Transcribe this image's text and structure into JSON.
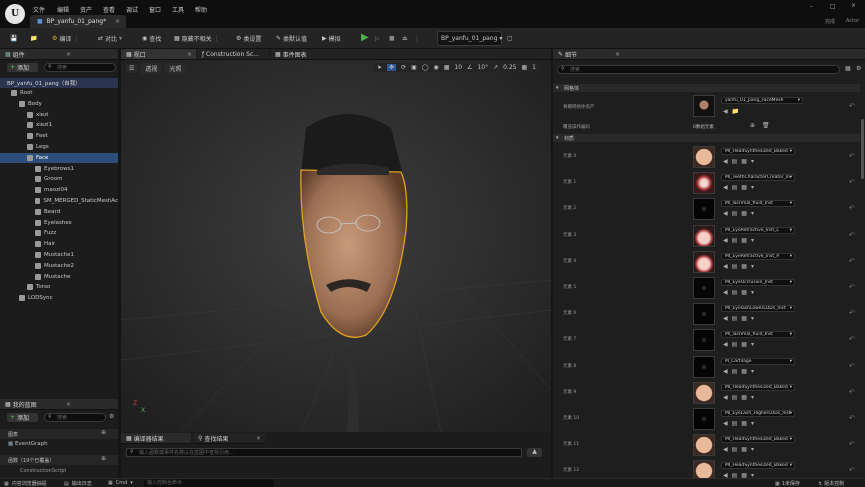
{
  "app": {
    "logo_text": "U",
    "doc_tab": "BP_yanfu_01_pang*",
    "window_right": "Actor",
    "window_right_prefix": "完成"
  },
  "menu": [
    "文件",
    "编辑",
    "资产",
    "查看",
    "调试",
    "窗口",
    "工具",
    "帮助"
  ],
  "toolbar": {
    "compile": "编译",
    "diff": "对比",
    "find": "查找",
    "hide_unrelated": "隐藏不相关",
    "class_settings": "类设置",
    "class_defaults": "类默认值",
    "simulate": "模拟",
    "debug_target": "BP_yanfu_01_pang"
  },
  "components": {
    "title": "组件",
    "add": "添加",
    "search_placeholder": "搜索",
    "root_label": "BP_yanfu_01_pang（自我）",
    "items": [
      {
        "label": "Root",
        "indent": 0
      },
      {
        "label": "Body",
        "indent": 1
      },
      {
        "label": "xiezi",
        "indent": 2
      },
      {
        "label": "xiezi1",
        "indent": 2
      },
      {
        "label": "Feet",
        "indent": 2
      },
      {
        "label": "Legs",
        "indent": 2
      },
      {
        "label": "Face",
        "indent": 2,
        "selected": true
      },
      {
        "label": "Eyebrows1",
        "indent": 3
      },
      {
        "label": "Groom",
        "indent": 3
      },
      {
        "label": "maozi04",
        "indent": 3
      },
      {
        "label": "SM_MERGED_StaticMeshAc",
        "indent": 3
      },
      {
        "label": "Beard",
        "indent": 3
      },
      {
        "label": "Eyelashes",
        "indent": 3
      },
      {
        "label": "Fuzz",
        "indent": 3
      },
      {
        "label": "Hair",
        "indent": 3
      },
      {
        "label": "Mustache1",
        "indent": 3
      },
      {
        "label": "Mustache2",
        "indent": 3
      },
      {
        "label": "Mustache",
        "indent": 3
      },
      {
        "label": "Torso",
        "indent": 2
      },
      {
        "label": "LODSync",
        "indent": 1
      }
    ]
  },
  "my_blueprint": {
    "title": "我的蓝图",
    "add": "添加",
    "search_placeholder": "搜索",
    "graph_header": "图表",
    "event_graph": "EventGraph",
    "functions_header": "函数（19个已覆盖）",
    "partial": "ConstructionScript"
  },
  "viewport": {
    "tab": "视口",
    "tab2": "Construction Sc...",
    "tab3": "事件图表",
    "perspective": "透视",
    "lit": "光照",
    "grid": "10",
    "angle": "10°",
    "scale": "0.25",
    "cam": "1"
  },
  "compiler": {
    "tab1": "编译器结果",
    "tab2": "查找结果",
    "search_placeholder": "输入函数或事件名称以在蓝图中查找引用..."
  },
  "details": {
    "title": "细节",
    "search_placeholder": "搜索",
    "mesh_section": "网格体",
    "mesh_asset_label": "骨骼网格体资产",
    "mesh_asset_value": "yanfu_01_pang_FaceMesh",
    "override_label": "覆盖操作编码",
    "override_value": "0数组元素",
    "materials_section": "材质",
    "materials": [
      {
        "label": "元素 0",
        "value": "MI_HeadSynthesized_Baked",
        "thumb": "skin"
      },
      {
        "label": "元素 1",
        "value": "MI_TeethCharacterCreator_Inst",
        "thumb": "teeth"
      },
      {
        "label": "元素 2",
        "value": "MI_lacrimal_fluid_Inst",
        "thumb": "dark"
      },
      {
        "label": "元素 3",
        "value": "MI_EyeRefractive_Inst_L",
        "thumb": "eye"
      },
      {
        "label": "元素 4",
        "value": "MI_EyeRefractive_Inst_R",
        "thumb": "eye"
      },
      {
        "label": "元素 5",
        "value": "MI_EyeOcclusion_Inst",
        "thumb": "dark"
      },
      {
        "label": "元素 6",
        "value": "MI_EyelashLowerLODs_Inst",
        "thumb": "dark"
      },
      {
        "label": "元素 7",
        "value": "MI_lacrimal_fluid_Inst",
        "thumb": "dark"
      },
      {
        "label": "元素 8",
        "value": "M_Cartilage",
        "thumb": "dark"
      },
      {
        "label": "元素 9",
        "value": "MI_HeadSynthesized_Baked",
        "thumb": "skin"
      },
      {
        "label": "元素 10",
        "value": "MI_EyeLash_HigherLODs_Inst",
        "thumb": "dark"
      },
      {
        "label": "元素 11",
        "value": "MI_HeadSynthesized_Baked",
        "thumb": "skin"
      },
      {
        "label": "元素 12",
        "value": "MI_HeadSynthesized_Baked",
        "thumb": "skin"
      }
    ]
  },
  "statusbar": {
    "drawer": "内容浏览器抽屉",
    "output": "输出日志",
    "cmd": "Cmd",
    "console_placeholder": "输入控制台命令",
    "unsaved": "1未保存",
    "source_control": "版本控制"
  },
  "colors": {
    "accent": "#2b5797",
    "play": "#4caf50",
    "selected_row": "#2d4e78",
    "outline": "#e0a020"
  }
}
